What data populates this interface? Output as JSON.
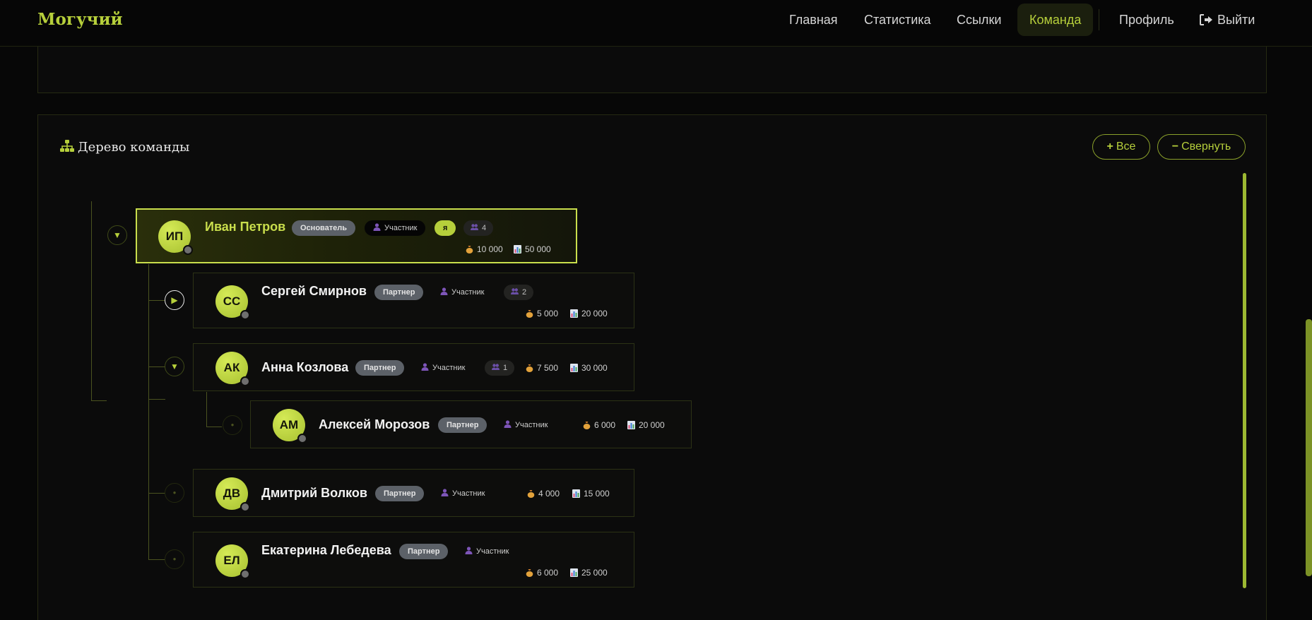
{
  "header": {
    "logo": "Могучий",
    "nav": {
      "home": "Главная",
      "stats": "Статистика",
      "links": "Ссылки",
      "team": "Команда",
      "profile": "Профиль",
      "logout": "Выйти"
    }
  },
  "tree": {
    "title": "Дерево команды",
    "expand_label": "Все",
    "collapse_label": "Свернуть",
    "toggles": {
      "expanded": "▼",
      "collapsed": "▶",
      "leaf": "●"
    },
    "members": [
      {
        "initials": "ИП",
        "name": "Иван Петров",
        "rank": "Основатель",
        "role": "Участник",
        "me_tag": "я",
        "team_count": "4",
        "balance": "10 000",
        "volume": "50 000"
      },
      {
        "initials": "СС",
        "name": "Сергей Смирнов",
        "rank": "Партнер",
        "role": "Участник",
        "team_count": "2",
        "balance": "5 000",
        "volume": "20 000"
      },
      {
        "initials": "АК",
        "name": "Анна Козлова",
        "rank": "Партнер",
        "role": "Участник",
        "team_count": "1",
        "balance": "7 500",
        "volume": "30 000"
      },
      {
        "initials": "АМ",
        "name": "Алексей Морозов",
        "rank": "Партнер",
        "role": "Участник",
        "balance": "6 000",
        "volume": "20 000"
      },
      {
        "initials": "ДВ",
        "name": "Дмитрий Волков",
        "rank": "Партнер",
        "role": "Участник",
        "balance": "4 000",
        "volume": "15 000"
      },
      {
        "initials": "ЕЛ",
        "name": "Екатерина Лебедева",
        "rank": "Партнер",
        "role": "Участник",
        "balance": "6 000",
        "volume": "25 000"
      }
    ]
  },
  "colors": {
    "accent": "#b6cf3b",
    "background": "#070707",
    "badge": "#5c6168"
  }
}
